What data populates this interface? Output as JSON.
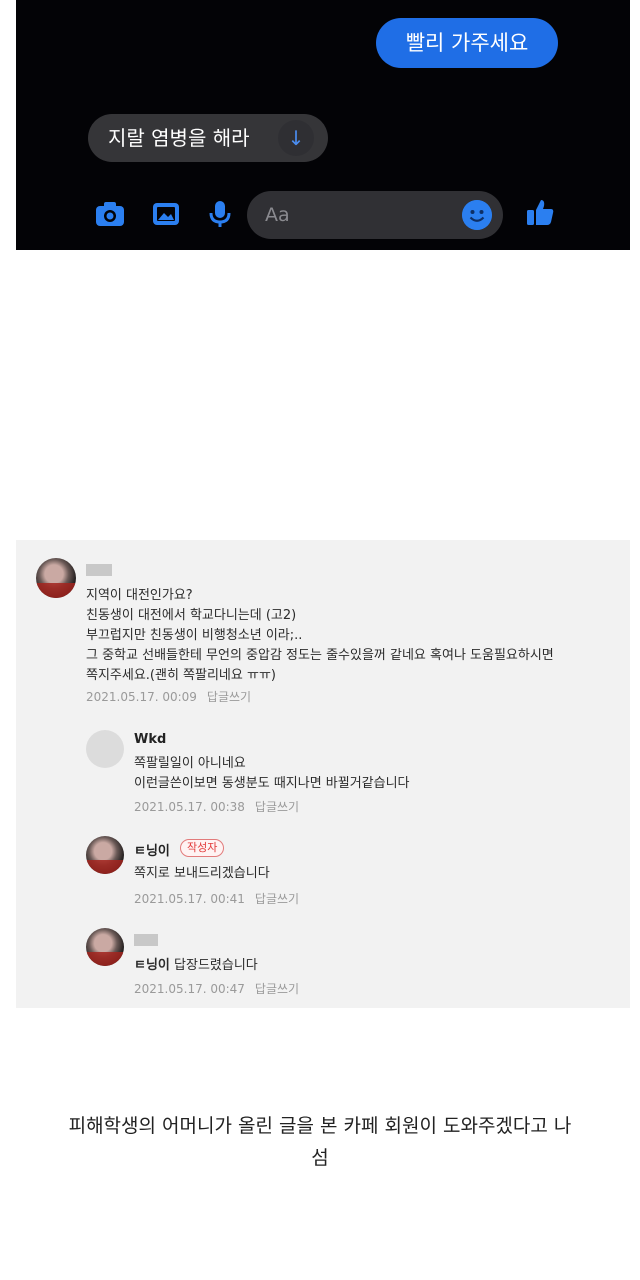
{
  "messenger": {
    "sent_message": "빨리 가주세요",
    "received_message": "지랄 염병을 해라 ",
    "input_placeholder": "Aa",
    "accent_color": "#1f6ee6",
    "icons": [
      "camera-icon",
      "image-icon",
      "microphone-icon",
      "emoji-icon",
      "thumbs-up-icon",
      "arrow-down-icon"
    ]
  },
  "comments": [
    {
      "lines": [
        "지역이 대전인가요?",
        "친동생이 대전에서 학교다니는데 (고2)",
        "부끄럽지만 친동생이 비행청소년 이라;..",
        "그 중학교 선배들한테 무언의 중압감 정도는 줄수있을꺼 같네요 혹여나 도움필요하시면",
        "쪽지주세요.(괜히 쪽팔리네요 ㅠㅠ)"
      ],
      "date": "2021.05.17. 00:09",
      "reply": "답글쓰기"
    },
    {
      "nickname": "Wkd",
      "lines": [
        "쪽팔릴일이 아니네요",
        "이런글쓴이보면 동생분도 때지나면 바뀔거같습니다"
      ],
      "date": "2021.05.17. 00:38",
      "reply": "답글쓰기"
    },
    {
      "nickname": "ㅌ닝이",
      "badge": "작성자",
      "lines": [
        "쪽지로 보내드리겠습니다"
      ],
      "date": "2021.05.17. 00:41",
      "reply": "답글쓰기"
    },
    {
      "mention": "ㅌ닝이",
      "lines": [
        " 답장드렸습니다"
      ],
      "date": "2021.05.17. 00:47",
      "reply": "답글쓰기"
    }
  ],
  "caption": {
    "line1": "피해학생의 어머니가 올린 글을 본 카페 회원이 도와주겠다고 나",
    "line2": "섬"
  }
}
